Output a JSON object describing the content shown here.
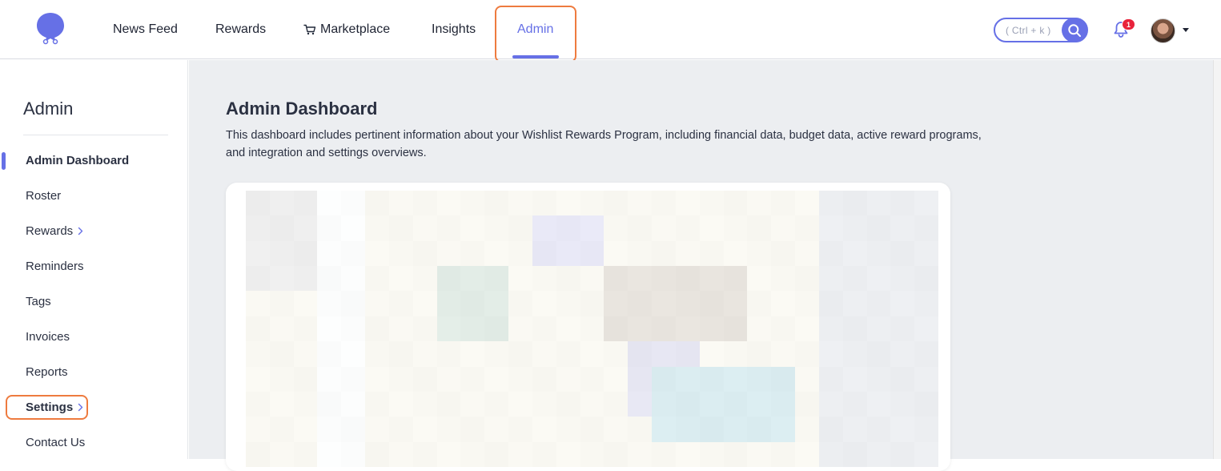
{
  "nav": {
    "items": [
      {
        "label": "News Feed"
      },
      {
        "label": "Rewards"
      },
      {
        "label": "Marketplace"
      },
      {
        "label": "Insights"
      },
      {
        "label": "Admin"
      }
    ],
    "active": "Admin"
  },
  "search": {
    "placeholder": "( Ctrl + k )"
  },
  "notifications": {
    "count": "1"
  },
  "sidebar": {
    "title": "Admin",
    "items": [
      {
        "label": "Admin Dashboard"
      },
      {
        "label": "Roster"
      },
      {
        "label": "Rewards"
      },
      {
        "label": "Reminders"
      },
      {
        "label": "Tags"
      },
      {
        "label": "Invoices"
      },
      {
        "label": "Reports"
      },
      {
        "label": "Settings"
      },
      {
        "label": "Contact Us"
      }
    ]
  },
  "main": {
    "title": "Admin Dashboard",
    "description": "This dashboard includes pertinent information about your Wishlist Rewards Program, including financial data, budget data, active reward programs, and integration and settings overviews."
  },
  "colors": {
    "accent": "#6670e6",
    "highlight": "#ee7b3f",
    "badge": "#e8223b",
    "background": "#eceef1"
  },
  "icons": [
    "wishlist-logo-icon",
    "cart-icon",
    "search-icon",
    "bell-icon",
    "chevron-right-icon",
    "caret-down-icon"
  ]
}
